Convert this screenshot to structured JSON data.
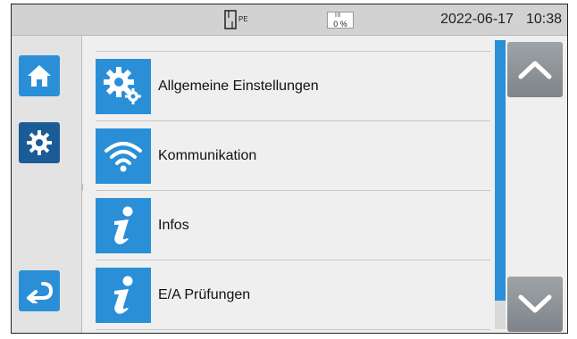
{
  "status_bar": {
    "plug": {
      "label": "PE"
    },
    "battery": {
      "percent": "0 %"
    },
    "date": "2022-06-17",
    "time": "10:38"
  },
  "nav": {
    "items": [
      {
        "icon": "home-icon"
      },
      {
        "icon": "gear-icon",
        "active": true
      },
      {
        "icon": "back-arrow-icon"
      }
    ]
  },
  "menu": {
    "items": [
      {
        "label": "Allgemeine Einstellungen",
        "icon": "gears-icon"
      },
      {
        "label": "Kommunikation",
        "icon": "wifi-icon"
      },
      {
        "label": "Infos",
        "icon": "info-icon"
      },
      {
        "label": "E/A Prüfungen",
        "icon": "info-icon"
      }
    ]
  },
  "scroll": {
    "position_fraction": 0.0,
    "visible_fraction": 0.9
  },
  "colors": {
    "accent": "#2b8fd8",
    "active": "#1c5c96",
    "scroll_button": "#8a9095",
    "status_bar": "#d2d2d2"
  }
}
